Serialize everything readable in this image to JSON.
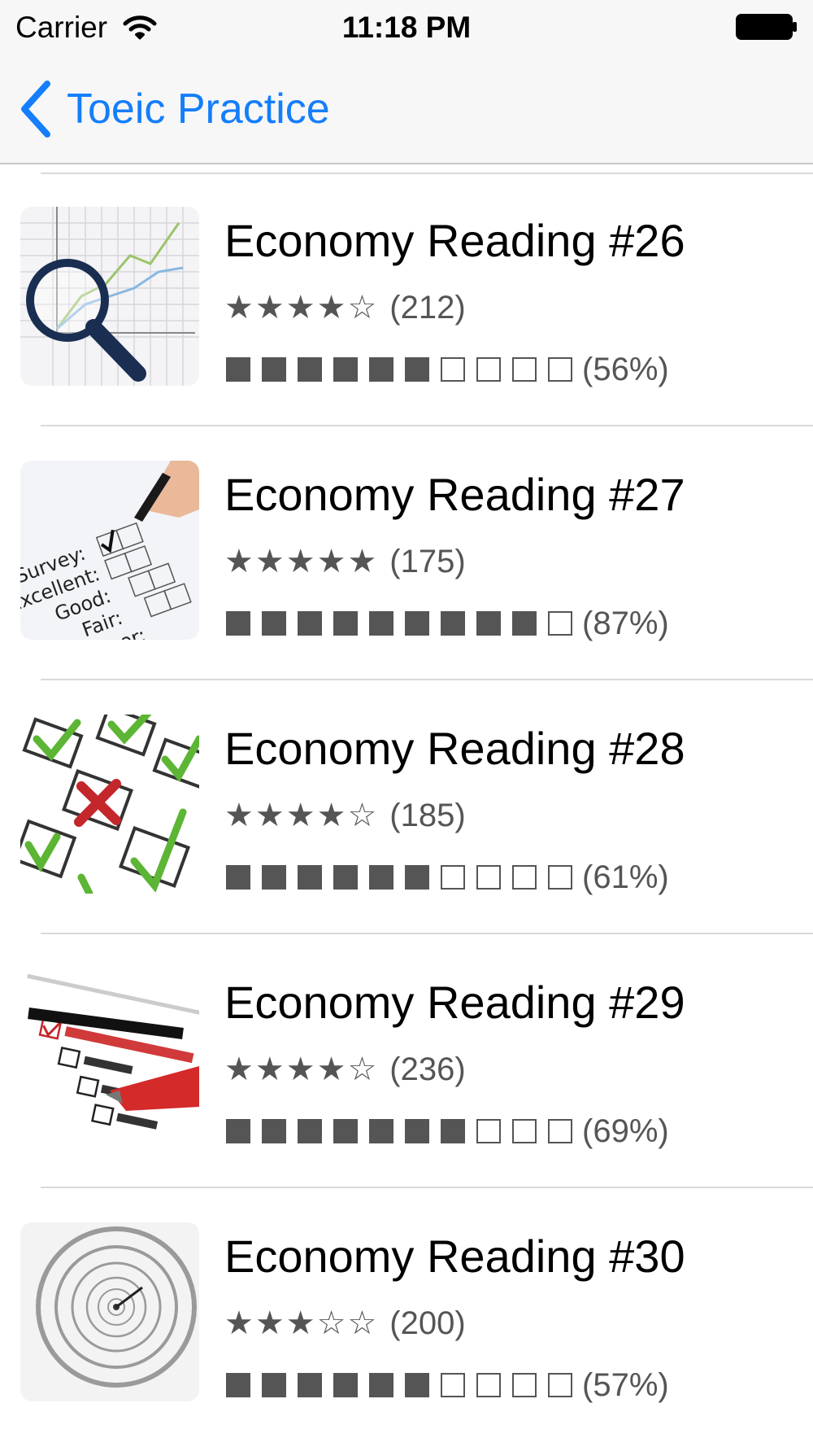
{
  "status_bar": {
    "carrier": "Carrier",
    "time": "11:18 PM",
    "wifi_icon": "wifi-icon",
    "battery_icon": "battery-full-icon"
  },
  "nav": {
    "back_label": "Toeic Practice",
    "back_icon": "chevron-left-icon",
    "accent_color": "#147efb"
  },
  "items": [
    {
      "title": "Economy Reading #26",
      "stars": "★★★★☆",
      "rating": 4,
      "count": "(212)",
      "progress": 0.56,
      "percent": "(56%)",
      "thumbnail_icon": "magnifier-chart-icon"
    },
    {
      "title": "Economy Reading #27",
      "stars": "★★★★★",
      "rating": 5,
      "count": "(175)",
      "progress": 0.87,
      "percent": "(87%)",
      "thumbnail_icon": "survey-form-icon"
    },
    {
      "title": "Economy Reading #28",
      "stars": "★★★★☆",
      "rating": 4,
      "count": "(185)",
      "progress": 0.61,
      "percent": "(61%)",
      "thumbnail_icon": "checkmarks-icon"
    },
    {
      "title": "Economy Reading #29",
      "stars": "★★★★☆",
      "rating": 4,
      "count": "(236)",
      "progress": 0.69,
      "percent": "(69%)",
      "thumbnail_icon": "evaluation-form-icon"
    },
    {
      "title": "Economy Reading #30",
      "stars": "★★★☆☆",
      "rating": 3,
      "count": "(200)",
      "progress": 0.57,
      "percent": "(57%)",
      "thumbnail_icon": "spiral-clock-icon"
    }
  ],
  "progress_segments": 10
}
